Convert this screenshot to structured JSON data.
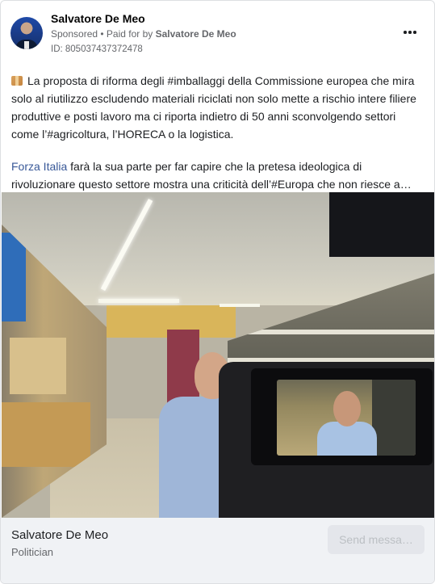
{
  "post": {
    "author": "Salvatore De Meo",
    "sponsored_label": "Sponsored",
    "separator": " • ",
    "paid_for_prefix": "Paid for by ",
    "paid_for_name": "Salvatore De Meo",
    "ad_id": "ID: 805037437372478",
    "more_icon": "more-horizontal-icon",
    "text": {
      "para1": "La proposta di riforma degli #imballaggi della Commissione europea che mira solo al riutilizzo escludendo materiali riciclati non solo mette a rischio intere filiere produttive e posti lavoro ma ci riporta indietro di 50 anni sconvolgendo settori come l’#agricoltura, l’HORECA o la logistica.",
      "link": "Forza Italia",
      "para2_rest": " farà la sua parte per far capire che la pretesa ideologica di rivoluzionare questo settore mostra una criticità dell’#Europa che non riesce a…"
    },
    "leading_icon": "package-icon"
  },
  "footer": {
    "name": "Salvatore De Meo",
    "category": "Politician",
    "cta_label": "Send messa…"
  },
  "colors": {
    "link": "#385898",
    "secondary_text": "#65676b",
    "footer_bg": "#f0f2f5",
    "cta_bg": "#e4e6eb"
  }
}
